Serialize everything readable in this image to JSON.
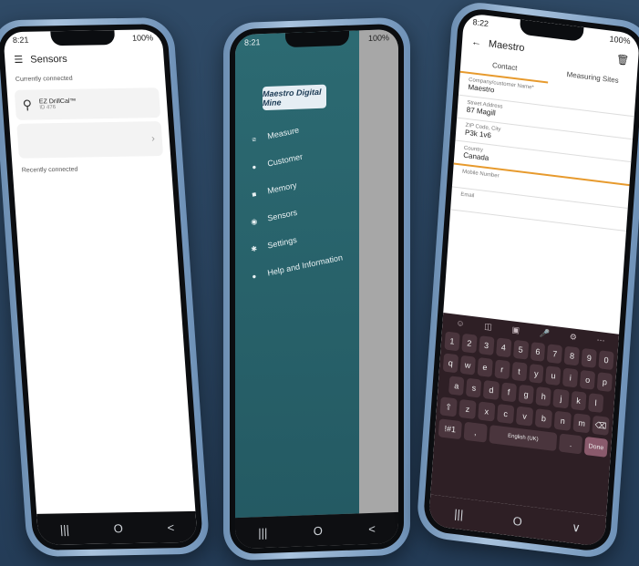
{
  "phone_left": {
    "status_time": "8:21",
    "status_right": "100%",
    "title": "Sensors",
    "connected_label": "Currently connected",
    "sensor_name": "EZ DrillCal™",
    "sensor_id": "ID 476",
    "recent_label": "Recently connected",
    "nav": [
      "|||",
      "O",
      "<"
    ]
  },
  "phone_middle": {
    "status_time": "8:21",
    "status_right": "100%",
    "brand": "Maestro Digital Mine",
    "menu": [
      {
        "label": "Measure",
        "icon": "measure-icon",
        "glyph": "≡"
      },
      {
        "label": "Customer",
        "icon": "person-icon",
        "glyph": "●"
      },
      {
        "label": "Memory",
        "icon": "memory-icon",
        "glyph": "■"
      },
      {
        "label": "Sensors",
        "icon": "sensor-icon",
        "glyph": "◉"
      },
      {
        "label": "Settings",
        "icon": "gear-icon",
        "glyph": "✱"
      },
      {
        "label": "Help and Information",
        "icon": "help-icon",
        "glyph": "●"
      }
    ],
    "nav": [
      "|||",
      "O",
      "<"
    ]
  },
  "phone_right": {
    "status_time": "8:22",
    "status_right": "100%",
    "title": "Maestro",
    "tabs": [
      "Contact",
      "Measuring Sites"
    ],
    "fields": [
      {
        "label": "Company/customer Name*",
        "value": "Maestro"
      },
      {
        "label": "Street Address",
        "value": "87 Magill"
      },
      {
        "label": "ZIP Code, City",
        "value": "P3k 1v6"
      },
      {
        "label": "Country",
        "value": "Canada"
      },
      {
        "label": "Mobile Number",
        "value": ""
      },
      {
        "label": "Email",
        "value": ""
      }
    ],
    "keyboard": {
      "numbers": [
        "1",
        "2",
        "3",
        "4",
        "5",
        "6",
        "7",
        "8",
        "9",
        "0"
      ],
      "row1": [
        "q",
        "w",
        "e",
        "r",
        "t",
        "y",
        "u",
        "i",
        "o",
        "p"
      ],
      "row2": [
        "a",
        "s",
        "d",
        "f",
        "g",
        "h",
        "j",
        "k",
        "l"
      ],
      "row3": [
        "⇧",
        "z",
        "x",
        "c",
        "v",
        "b",
        "n",
        "m",
        "⌫"
      ],
      "space_label": "English (UK)",
      "sym_label": "!#1",
      "done_label": "Done"
    },
    "nav": [
      "|||",
      "O",
      "∨"
    ]
  },
  "colors": {
    "background": "#2c4663",
    "drawer": "#2a6670",
    "accent": "#e79a2d",
    "keyboard": "#2e1f25"
  }
}
